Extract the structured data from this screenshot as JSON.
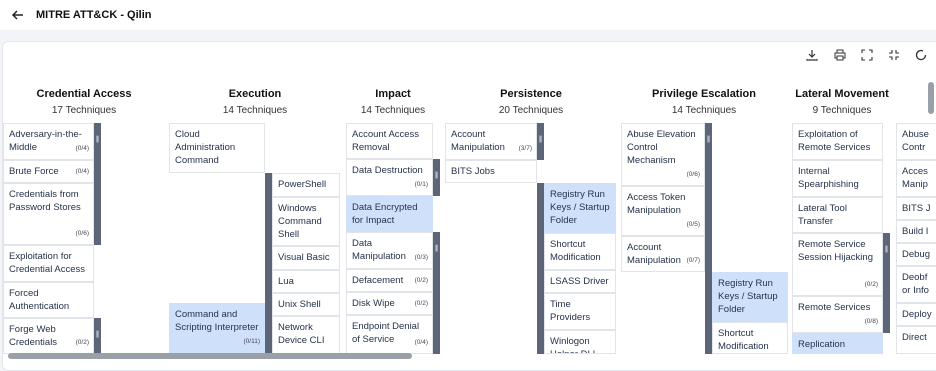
{
  "header": {
    "title": "MITRE ATT&CK - Qilin",
    "back_icon": "arrow-left-icon"
  },
  "toolbar": {
    "icons": [
      "download-icon",
      "print-icon",
      "expand-icon",
      "collapse-icon",
      "refresh-icon"
    ]
  },
  "columns": {
    "credential_access": {
      "name": "Credential Access",
      "count": "17 Techniques",
      "items": [
        "Adversary-in-the-Middle",
        "Brute Force",
        "Credentials from Password Stores",
        "Exploitation for Credential Access",
        "Forced Authentication",
        "Forge Web Credentials"
      ],
      "subs": [
        "(0/4)",
        "(0/4)",
        "(0/6)",
        "(0/2)"
      ]
    },
    "execution": {
      "name": "Execution",
      "count": "14 Techniques",
      "items": [
        "Cloud Administration Command",
        "Command and Scripting Interpreter"
      ],
      "subs": [
        "(0/11)"
      ],
      "sub_items": [
        "PowerShell",
        "Windows Command Shell",
        "Visual Basic",
        "Lua",
        "Unix Shell",
        "Network Device CLI"
      ]
    },
    "impact": {
      "name": "Impact",
      "count": "14 Techniques",
      "items": [
        "Account Access Removal",
        "Data Destruction",
        "Data Encrypted for Impact",
        "Data Manipulation",
        "Defacement",
        "Disk Wipe",
        "Endpoint Denial of Service"
      ],
      "subs": [
        "(0/1)",
        "(0/3)",
        "(0/2)",
        "(0/2)",
        "(0/4)"
      ]
    },
    "persistence": {
      "name": "Persistence",
      "count": "20 Techniques",
      "items": [
        "Account Manipulation",
        "BITS Jobs"
      ],
      "subs": [
        "(3/7)"
      ],
      "sub_items": [
        "Registry Run Keys / Startup Folder",
        "Shortcut Modification",
        "LSASS Driver",
        "Time Providers",
        "Winlogon Helper DLL"
      ]
    },
    "privilege_escalation": {
      "name": "Privilege Escalation",
      "count": "14 Techniques",
      "items": [
        "Abuse Elevation Control Mechanism",
        "Access Token Manipulation",
        "Account Manipulation"
      ],
      "subs": [
        "(0/6)",
        "(0/5)",
        "(0/7)"
      ],
      "sub_items": [
        "Registry Run Keys / Startup Folder",
        "Shortcut Modification"
      ]
    },
    "lateral_movement": {
      "name": "Lateral Movement",
      "count": "9 Techniques",
      "items": [
        "Exploitation of Remote Services",
        "Internal Spearphishing",
        "Lateral Tool Transfer",
        "Remote Service Session Hijacking",
        "Remote Services",
        "Replication"
      ],
      "subs": [
        "(0/2)",
        "(0/8)"
      ]
    },
    "next": {
      "items": [
        "Abuse Contr",
        "Acces Manip",
        "BITS J",
        "Build I",
        "Debug",
        "Deobf or Info",
        "Deploy",
        "Direct"
      ]
    }
  },
  "colors": {
    "highlight": "#cfe0fb",
    "bar": "#5c6678"
  }
}
